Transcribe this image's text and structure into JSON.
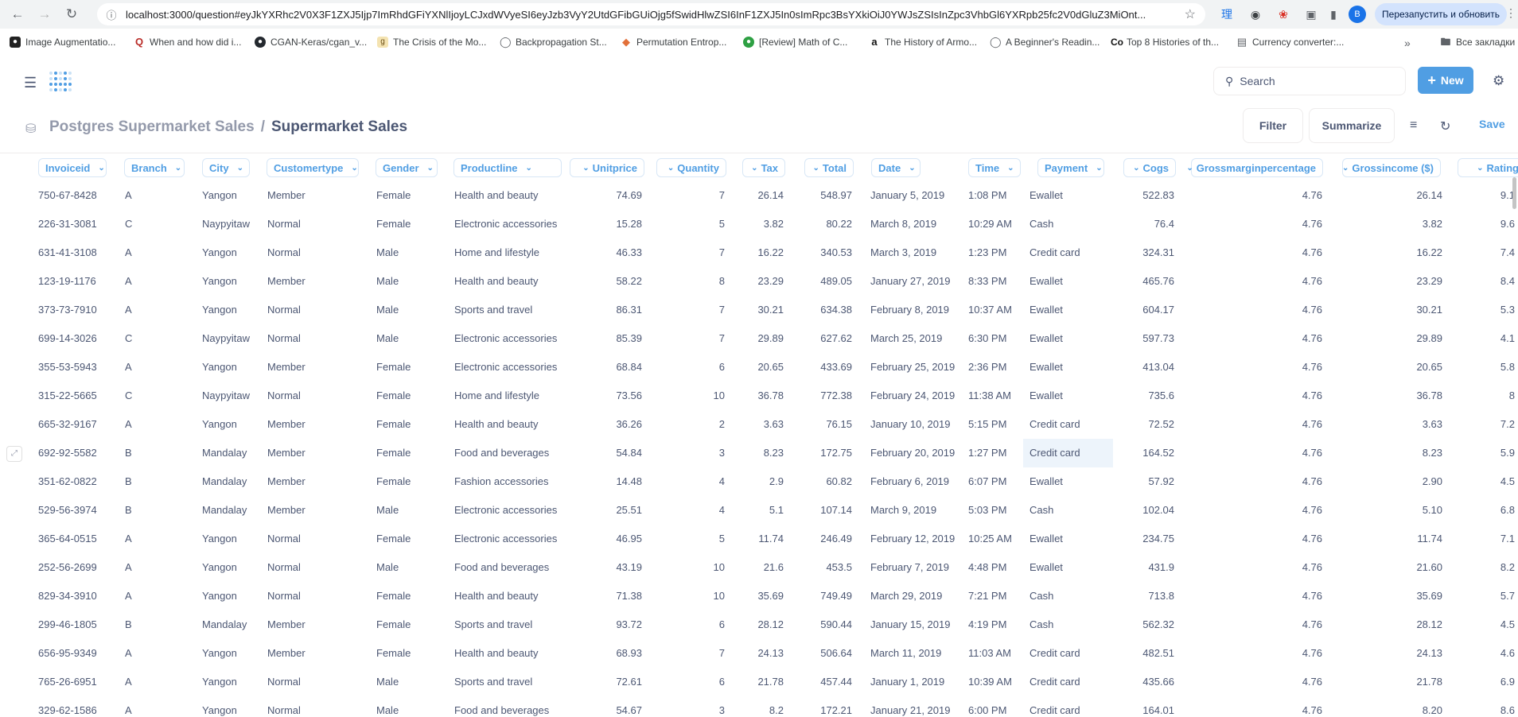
{
  "browser": {
    "url": "localhost:3000/question#eyJkYXRhc2V0X3F1ZXJ5Ijp7ImRhdGFiYXNlIjoyLCJxdWVyeSI6eyJzb3VyY2UtdGFibGUiOjg5fSwidHlwZSI6InF1ZXJ5In0sImRpc3BsYXkiOiJ0YWJsZSIsInZpc3VhbGl6YXRpb25fc2V0dGluZ3MiOnt...",
    "profile_initial": "B",
    "relaunch_label": "Перезапустить и обновить",
    "bookmarks": [
      {
        "label": "Image Augmentatio..."
      },
      {
        "label": "When and how did i..."
      },
      {
        "label": "CGAN-Keras/cgan_v..."
      },
      {
        "label": "The Crisis of the Mo..."
      },
      {
        "label": "Backpropagation St..."
      },
      {
        "label": "Permutation Entrop..."
      },
      {
        "label": "[Review] Math of C..."
      },
      {
        "label": "The History of Armo..."
      },
      {
        "label": "A Beginner's Readin..."
      },
      {
        "label": "Top 8 Histories of th..."
      },
      {
        "label": "Currency converter:..."
      }
    ],
    "bookmarks_folder": "Все закладки"
  },
  "app": {
    "search_placeholder": "Search",
    "new_label": "New",
    "breadcrumb_db": "Postgres Supermarket Sales",
    "breadcrumb_sep": "/",
    "breadcrumb_table": "Supermarket Sales",
    "filter_label": "Filter",
    "summarize_label": "Summarize",
    "save_label": "Save",
    "accent": "#509ee3"
  },
  "table": {
    "columns": [
      "Invoiceid",
      "Branch",
      "City",
      "Customertype",
      "Gender",
      "Productline",
      "Unitprice",
      "Quantity",
      "Tax",
      "Total",
      "Date",
      "Time",
      "Payment",
      "Cogs",
      "Grossmarginpercentage",
      "Grossincome ($)",
      "Rating"
    ],
    "rows": [
      [
        "750-67-8428",
        "A",
        "Yangon",
        "Member",
        "Female",
        "Health and beauty",
        "74.69",
        "7",
        "26.14",
        "548.97",
        "January 5, 2019",
        "1:08 PM",
        "Ewallet",
        "522.83",
        "4.76",
        "26.14",
        "9.1"
      ],
      [
        "226-31-3081",
        "C",
        "Naypyitaw",
        "Normal",
        "Female",
        "Electronic accessories",
        "15.28",
        "5",
        "3.82",
        "80.22",
        "March 8, 2019",
        "10:29 AM",
        "Cash",
        "76.4",
        "4.76",
        "3.82",
        "9.6"
      ],
      [
        "631-41-3108",
        "A",
        "Yangon",
        "Normal",
        "Male",
        "Home and lifestyle",
        "46.33",
        "7",
        "16.22",
        "340.53",
        "March 3, 2019",
        "1:23 PM",
        "Credit card",
        "324.31",
        "4.76",
        "16.22",
        "7.4"
      ],
      [
        "123-19-1176",
        "A",
        "Yangon",
        "Member",
        "Male",
        "Health and beauty",
        "58.22",
        "8",
        "23.29",
        "489.05",
        "January 27, 2019",
        "8:33 PM",
        "Ewallet",
        "465.76",
        "4.76",
        "23.29",
        "8.4"
      ],
      [
        "373-73-7910",
        "A",
        "Yangon",
        "Normal",
        "Male",
        "Sports and travel",
        "86.31",
        "7",
        "30.21",
        "634.38",
        "February 8, 2019",
        "10:37 AM",
        "Ewallet",
        "604.17",
        "4.76",
        "30.21",
        "5.3"
      ],
      [
        "699-14-3026",
        "C",
        "Naypyitaw",
        "Normal",
        "Male",
        "Electronic accessories",
        "85.39",
        "7",
        "29.89",
        "627.62",
        "March 25, 2019",
        "6:30 PM",
        "Ewallet",
        "597.73",
        "4.76",
        "29.89",
        "4.1"
      ],
      [
        "355-53-5943",
        "A",
        "Yangon",
        "Member",
        "Female",
        "Electronic accessories",
        "68.84",
        "6",
        "20.65",
        "433.69",
        "February 25, 2019",
        "2:36 PM",
        "Ewallet",
        "413.04",
        "4.76",
        "20.65",
        "5.8"
      ],
      [
        "315-22-5665",
        "C",
        "Naypyitaw",
        "Normal",
        "Female",
        "Home and lifestyle",
        "73.56",
        "10",
        "36.78",
        "772.38",
        "February 24, 2019",
        "11:38 AM",
        "Ewallet",
        "735.6",
        "4.76",
        "36.78",
        "8"
      ],
      [
        "665-32-9167",
        "A",
        "Yangon",
        "Member",
        "Female",
        "Health and beauty",
        "36.26",
        "2",
        "3.63",
        "76.15",
        "January 10, 2019",
        "5:15 PM",
        "Credit card",
        "72.52",
        "4.76",
        "3.63",
        "7.2"
      ],
      [
        "692-92-5582",
        "B",
        "Mandalay",
        "Member",
        "Female",
        "Food and beverages",
        "54.84",
        "3",
        "8.23",
        "172.75",
        "February 20, 2019",
        "1:27 PM",
        "Credit card",
        "164.52",
        "4.76",
        "8.23",
        "5.9"
      ],
      [
        "351-62-0822",
        "B",
        "Mandalay",
        "Member",
        "Female",
        "Fashion accessories",
        "14.48",
        "4",
        "2.9",
        "60.82",
        "February 6, 2019",
        "6:07 PM",
        "Ewallet",
        "57.92",
        "4.76",
        "2.90",
        "4.5"
      ],
      [
        "529-56-3974",
        "B",
        "Mandalay",
        "Member",
        "Male",
        "Electronic accessories",
        "25.51",
        "4",
        "5.1",
        "107.14",
        "March 9, 2019",
        "5:03 PM",
        "Cash",
        "102.04",
        "4.76",
        "5.10",
        "6.8"
      ],
      [
        "365-64-0515",
        "A",
        "Yangon",
        "Normal",
        "Female",
        "Electronic accessories",
        "46.95",
        "5",
        "11.74",
        "246.49",
        "February 12, 2019",
        "10:25 AM",
        "Ewallet",
        "234.75",
        "4.76",
        "11.74",
        "7.1"
      ],
      [
        "252-56-2699",
        "A",
        "Yangon",
        "Normal",
        "Male",
        "Food and beverages",
        "43.19",
        "10",
        "21.6",
        "453.5",
        "February 7, 2019",
        "4:48 PM",
        "Ewallet",
        "431.9",
        "4.76",
        "21.60",
        "8.2"
      ],
      [
        "829-34-3910",
        "A",
        "Yangon",
        "Normal",
        "Female",
        "Health and beauty",
        "71.38",
        "10",
        "35.69",
        "749.49",
        "March 29, 2019",
        "7:21 PM",
        "Cash",
        "713.8",
        "4.76",
        "35.69",
        "5.7"
      ],
      [
        "299-46-1805",
        "B",
        "Mandalay",
        "Member",
        "Female",
        "Sports and travel",
        "93.72",
        "6",
        "28.12",
        "590.44",
        "January 15, 2019",
        "4:19 PM",
        "Cash",
        "562.32",
        "4.76",
        "28.12",
        "4.5"
      ],
      [
        "656-95-9349",
        "A",
        "Yangon",
        "Member",
        "Female",
        "Health and beauty",
        "68.93",
        "7",
        "24.13",
        "506.64",
        "March 11, 2019",
        "11:03 AM",
        "Credit card",
        "482.51",
        "4.76",
        "24.13",
        "4.6"
      ],
      [
        "765-26-6951",
        "A",
        "Yangon",
        "Normal",
        "Male",
        "Sports and travel",
        "72.61",
        "6",
        "21.78",
        "457.44",
        "January 1, 2019",
        "10:39 AM",
        "Credit card",
        "435.66",
        "4.76",
        "21.78",
        "6.9"
      ],
      [
        "329-62-1586",
        "A",
        "Yangon",
        "Normal",
        "Male",
        "Food and beverages",
        "54.67",
        "3",
        "8.2",
        "172.21",
        "January 21, 2019",
        "6:00 PM",
        "Credit card",
        "164.01",
        "4.76",
        "8.20",
        "8.6"
      ]
    ],
    "highlighted": {
      "row": 9,
      "col": 12
    }
  }
}
